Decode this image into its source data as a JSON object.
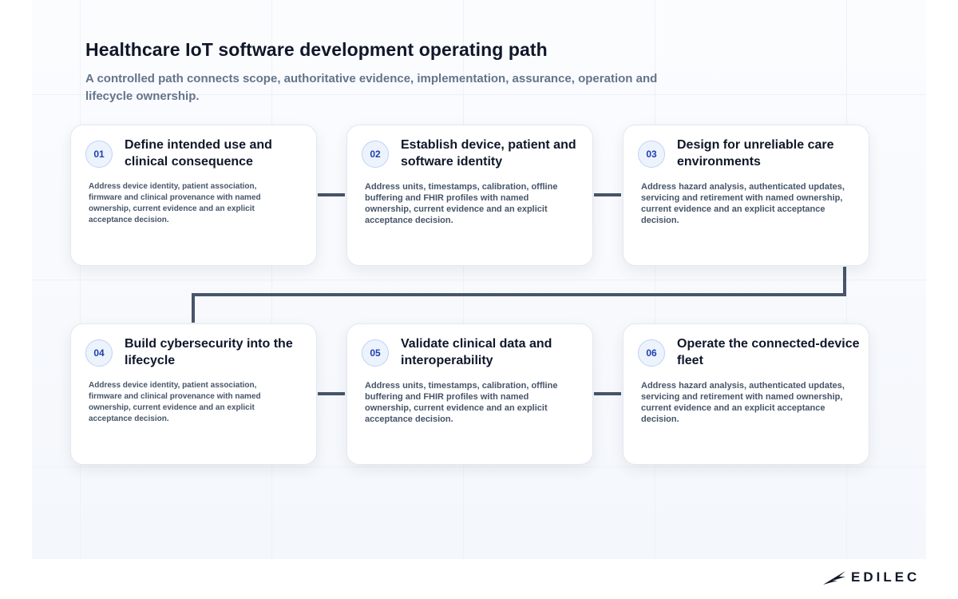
{
  "page": {
    "title": "Healthcare IoT software development operating path",
    "subtitle": "A controlled path connects scope, authoritative evidence, implementation, assurance, operation and lifecycle ownership."
  },
  "steps": [
    {
      "number": "01",
      "title": "Define intended use and clinical consequence",
      "body": "Address device identity, patient association, firmware and clinical provenance with named ownership, current evidence and an explicit acceptance decision."
    },
    {
      "number": "02",
      "title": "Establish device, patient and software identity",
      "body": "Address units, timestamps, calibration, offline buffering and FHIR profiles with named ownership, current evidence and an explicit acceptance decision."
    },
    {
      "number": "03",
      "title": "Design for unreliable care environments",
      "body": "Address hazard analysis, authenticated updates, servicing and retirement with named ownership, current evidence and an explicit acceptance decision."
    },
    {
      "number": "04",
      "title": "Build cybersecurity into the lifecycle",
      "body": "Address device identity, patient association, firmware and clinical provenance with named ownership, current evidence and an explicit acceptance decision."
    },
    {
      "number": "05",
      "title": "Validate clinical data and interoperability",
      "body": "Address units, timestamps, calibration, offline buffering and FHIR profiles with named ownership, current evidence and an explicit acceptance decision."
    },
    {
      "number": "06",
      "title": "Operate the connected-device fleet",
      "body": "Address hazard analysis, authenticated updates, servicing and retirement with named ownership, current evidence and an explicit acceptance decision."
    }
  ],
  "brand": {
    "logo_text": "EDILEC",
    "logo_icon": "edilec-wing-logo"
  },
  "colors": {
    "connector": "#475569",
    "badge_text": "#1e40af",
    "badge_bg": "#edf3fd",
    "title_text": "#0f172a",
    "subtitle_text": "#64748b",
    "body_text": "#475569"
  }
}
